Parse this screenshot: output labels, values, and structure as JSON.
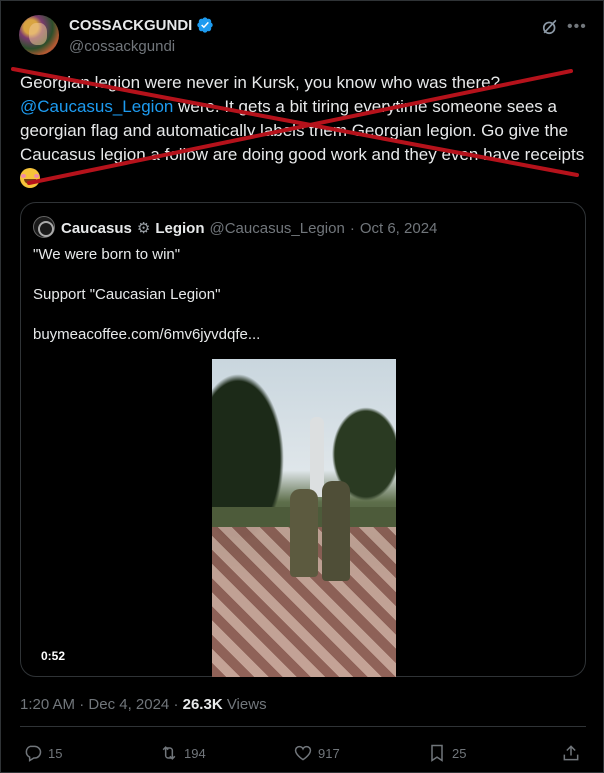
{
  "author": {
    "display_name": "COSSACKGUNDI",
    "handle": "@cossackgundi"
  },
  "tweet": {
    "text_before": "Georgian legion were never in Kursk, you know who was there? ",
    "mention": "@Caucasus_Legion",
    "text_after": " were. It gets a bit tiring everytime someone sees a georgian flag and automatically labels them Georgian legion.  Go give the Caucasus legion a follow are doing good work and they even have receipts "
  },
  "quote": {
    "display_name_1": "Caucasus",
    "display_name_2": "Legion",
    "handle": "@Caucasus_Legion",
    "separator": "·",
    "date": "Oct 6, 2024",
    "line1": "\"We were born to win\"",
    "line2": "Support \"Caucasian Legion\"",
    "line3": "buymeacoffee.com/6mv6jyvdqfe...",
    "video_duration": "0:52"
  },
  "meta": {
    "time": "1:20 AM",
    "separator": "·",
    "date": "Dec 4, 2024",
    "separator2": "·",
    "views_count": "26.3K",
    "views_label": "Views"
  },
  "actions": {
    "replies": "15",
    "reposts": "194",
    "likes": "917",
    "bookmarks": "25"
  },
  "colors": {
    "background": "#000000",
    "text": "#e7e9ea",
    "secondary": "#71767b",
    "accent": "#1d9bf0",
    "strike": "#b5121b"
  },
  "icons": [
    "verified-badge-icon",
    "grok-icon",
    "more-icon",
    "gear-emoji-icon",
    "grinning-emoji-icon",
    "reply-icon",
    "repost-icon",
    "like-icon",
    "bookmark-icon",
    "share-icon"
  ]
}
